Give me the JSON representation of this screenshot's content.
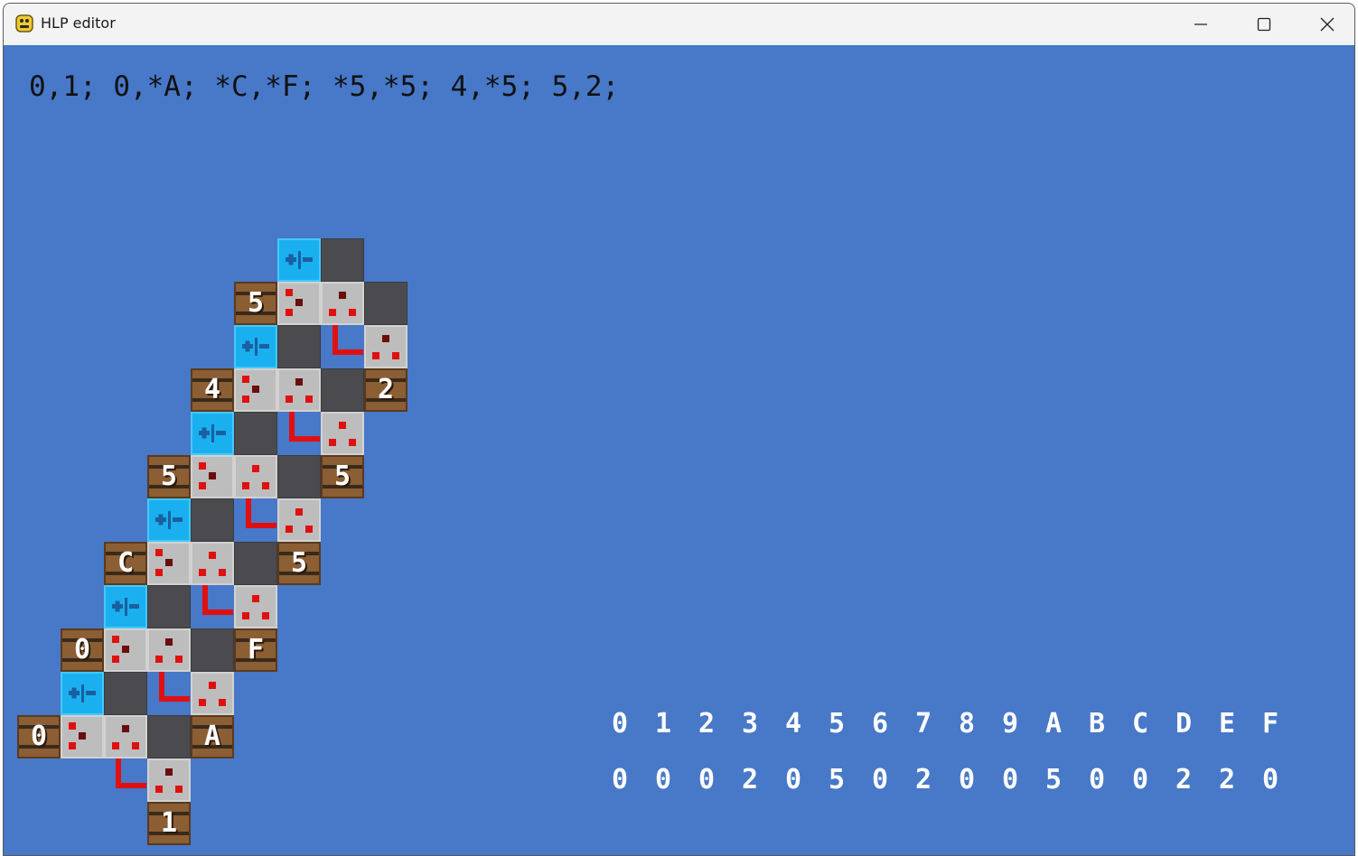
{
  "window": {
    "title": "HLP editor",
    "app_icon": "python-icon",
    "controls": {
      "minimize": "minimize-icon",
      "maximize": "maximize-icon",
      "close": "close-icon"
    }
  },
  "code": "0,1; 0,*A; *C,*F; *5,*5; 4,*5; 5,2;",
  "barrels": {
    "b0_left": "0",
    "b1_bottom": "1",
    "bA": "A",
    "b0_mid": "0",
    "bF": "F",
    "bC": "C",
    "b5_a": "5",
    "b5_b": "5",
    "b5_c": "5",
    "b4": "4",
    "b2": "2",
    "b5_top": "5"
  },
  "hex_table": {
    "headers": [
      "0",
      "1",
      "2",
      "3",
      "4",
      "5",
      "6",
      "7",
      "8",
      "9",
      "A",
      "B",
      "C",
      "D",
      "E",
      "F"
    ],
    "values": [
      "0",
      "0",
      "0",
      "2",
      "0",
      "5",
      "0",
      "2",
      "0",
      "0",
      "5",
      "0",
      "0",
      "2",
      "2",
      "0"
    ]
  },
  "colors": {
    "background": "#4878c8",
    "comparator_tile": "#1ab0f0",
    "lamp_tile": "#bdbdbd",
    "barrel_tile": "#8b5e34",
    "block_tile": "#4b4b4f",
    "redstone_wire": "#e01010"
  }
}
